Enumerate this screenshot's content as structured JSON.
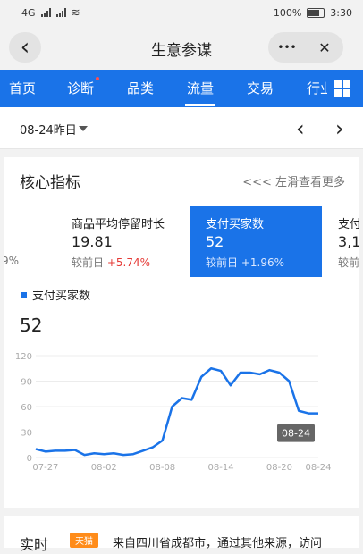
{
  "status_bar": {
    "network": "4G",
    "battery": "100%",
    "time": "3:30"
  },
  "title_bar": {
    "title": "生意参谋",
    "back_icon": "‹",
    "more_icon": "•••",
    "close_icon": "✕"
  },
  "tabs": [
    {
      "label": "首页",
      "active": false,
      "dot": false
    },
    {
      "label": "诊断",
      "active": false,
      "dot": true
    },
    {
      "label": "品类",
      "active": false,
      "dot": false
    },
    {
      "label": "流量",
      "active": true,
      "dot": false
    },
    {
      "label": "交易",
      "active": false,
      "dot": false
    },
    {
      "label": "行业",
      "active": false,
      "dot": false
    }
  ],
  "date_bar": {
    "date": "08-24昨日",
    "prev_icon": "‹",
    "next_icon": "›"
  },
  "core_metrics": {
    "title": "核心指标",
    "swipe_hint": "<<< 左滑查看更多",
    "prev_partial_change": "9%",
    "items": [
      {
        "label": "商品平均停留时长",
        "value": "19.81",
        "compare_label": "较前日",
        "change": "+5.74%",
        "selected": false
      },
      {
        "label": "支付买家数",
        "value": "52",
        "compare_label": "较前日",
        "change": "+1.96%",
        "selected": true
      },
      {
        "label": "支付",
        "value": "3,1",
        "compare_label": "较前",
        "change": "",
        "selected": false
      }
    ]
  },
  "chart_legend": "支付买家数",
  "chart_value": "52",
  "chart_data": {
    "type": "line",
    "series": [
      {
        "name": "支付买家数",
        "color": "#1a73e8",
        "values": [
          10,
          7,
          8,
          8,
          9,
          3,
          5,
          4,
          5,
          3,
          4,
          8,
          12,
          20,
          60,
          70,
          68,
          95,
          105,
          102,
          85,
          100,
          100,
          98,
          103,
          100,
          90,
          55,
          52,
          52
        ]
      }
    ],
    "x_dates": [
      "07-26",
      "07-27",
      "07-28",
      "07-29",
      "07-30",
      "07-31",
      "08-01",
      "08-02",
      "08-03",
      "08-04",
      "08-05",
      "08-06",
      "08-07",
      "08-08",
      "08-09",
      "08-10",
      "08-11",
      "08-12",
      "08-13",
      "08-14",
      "08-15",
      "08-16",
      "08-17",
      "08-18",
      "08-19",
      "08-20",
      "08-21",
      "08-22",
      "08-23",
      "08-24"
    ],
    "x_tick_labels": [
      "07-27",
      "08-02",
      "08-08",
      "08-14",
      "08-20",
      "08-24"
    ],
    "y_ticks": [
      0,
      30,
      60,
      90,
      120
    ],
    "ylim": [
      0,
      120
    ],
    "tooltip": "08-24"
  },
  "bottom_bar": {
    "title": "实时",
    "tag": "天猫",
    "text": "来自四川省成都市，通过其他来源，访问"
  }
}
